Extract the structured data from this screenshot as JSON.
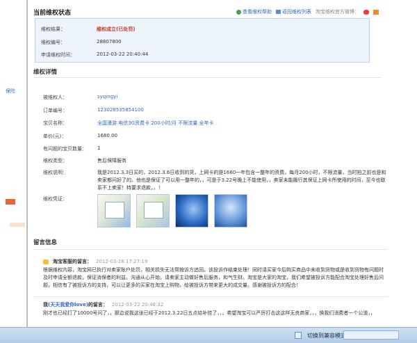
{
  "status": {
    "title": "当前维权状态",
    "help_link": "查看维权帮助",
    "back_link": "返回维权列表",
    "weibo_label": "淘宝维权官方微博：",
    "rows": [
      {
        "key": "维权结果：",
        "value": "维权成立(已处罚)"
      },
      {
        "key": "维权编号：",
        "value": "28807800"
      },
      {
        "key": "申请维权时间：",
        "value": "2012-03-22 20:40:44"
      }
    ]
  },
  "left": {
    "link": "保险"
  },
  "detail": {
    "title": "维权详情",
    "rows": [
      {
        "key": "被维权人：",
        "value": "syqingyi"
      },
      {
        "key": "订单编号：",
        "value": "123028535854100"
      },
      {
        "key": "宝贝名称：",
        "value": "全国漫游  电信3G资费卡  200小时/月  不限流量  全年卡"
      },
      {
        "key": "单价(元)：",
        "value": "1680.00"
      },
      {
        "key": "有问题的宝贝数量：",
        "value": "1"
      },
      {
        "key": "维权类型：",
        "value": "售后保障服务"
      },
      {
        "key": "维权说明：",
        "value": ""
      },
      {
        "key": "维权凭证：",
        "value": ""
      }
    ],
    "description": "我是2012.3.3日买的，2012.3.6日收到的货，上网卡的是1680一年包含一整年的资费，每月200小时，不限流量，当时拍之前也是和卖家都问好了的。他也是保证了可以用一整年的，，可是于3.22号晚上不能使用，，卖家未能履行其保证上网卡所使用的时间，至今也联系不上卖家！特要求退款，，！"
  },
  "messages": {
    "title": "留言信息",
    "items": [
      {
        "name": "淘宝客服的留言：",
        "time": "2012-03-28 17:27:19",
        "body": "根据维权内容，淘宝网已执行对卖家账户处罚，相关损失无法帮按诉方追回。该投诉作结束处理！同时请买家今后购买商品中未收到货物或是收到货物有问题时及时申请全额退款，保证消保者的利益。沟通从心开始，请卖家主动做好售后服务，和气生财。淘宝是大家的淘宝，我们希望被投诉方能配合淘宝处理好售后问题，相信有了被投诉方的支持，可以让更多的买家在淘宝上购物，给被投诉方带来更大的成交量。感谢被投诉方的配合！"
      },
      {
        "name_prefix": "我",
        "name_highlight": "(天天我爱你love)",
        "name_suffix": "的留言：",
        "time": "2012-03-22 20:48:32",
        "body": "刚才也已经打了10000号问了，，那边说我这张已经于2012.3.22日五点给补挂了，，，希望淘宝可以严厉打击这这样无良商家，，，换我们消费者一个公道，，"
      }
    ]
  },
  "taskbar": {
    "mode": "切换到兼容模式"
  }
}
